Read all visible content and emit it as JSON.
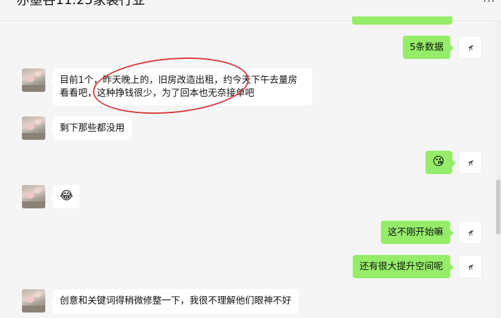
{
  "header": {
    "title": "亦墨谷11.25家装行业",
    "more": "···"
  },
  "messages": [
    {
      "side": "out",
      "text": "5条数据"
    },
    {
      "side": "in",
      "line1": "目前1个，昨天晚上的，旧房改造出租，约今天下午去量房",
      "line2": "看看吧，这种挣钱很少，为了回本也无奈接单吧"
    },
    {
      "side": "in",
      "text": "剩下那些都没用"
    },
    {
      "side": "out",
      "text": "😘",
      "emoji": true
    },
    {
      "side": "in",
      "text": "😂",
      "emoji": true
    },
    {
      "side": "out",
      "text": "这不刚开始嘛"
    },
    {
      "side": "out",
      "text": "还有很大提升空间呢"
    },
    {
      "side": "in",
      "text": "创意和关键词得稍微修整一下，我很不理解他们眼神不好"
    }
  ],
  "colors": {
    "background": "#f5f5f5",
    "outgoing_bubble": "#95ec69",
    "incoming_bubble": "#ffffff",
    "annotation_circle": "#d63a3a"
  }
}
